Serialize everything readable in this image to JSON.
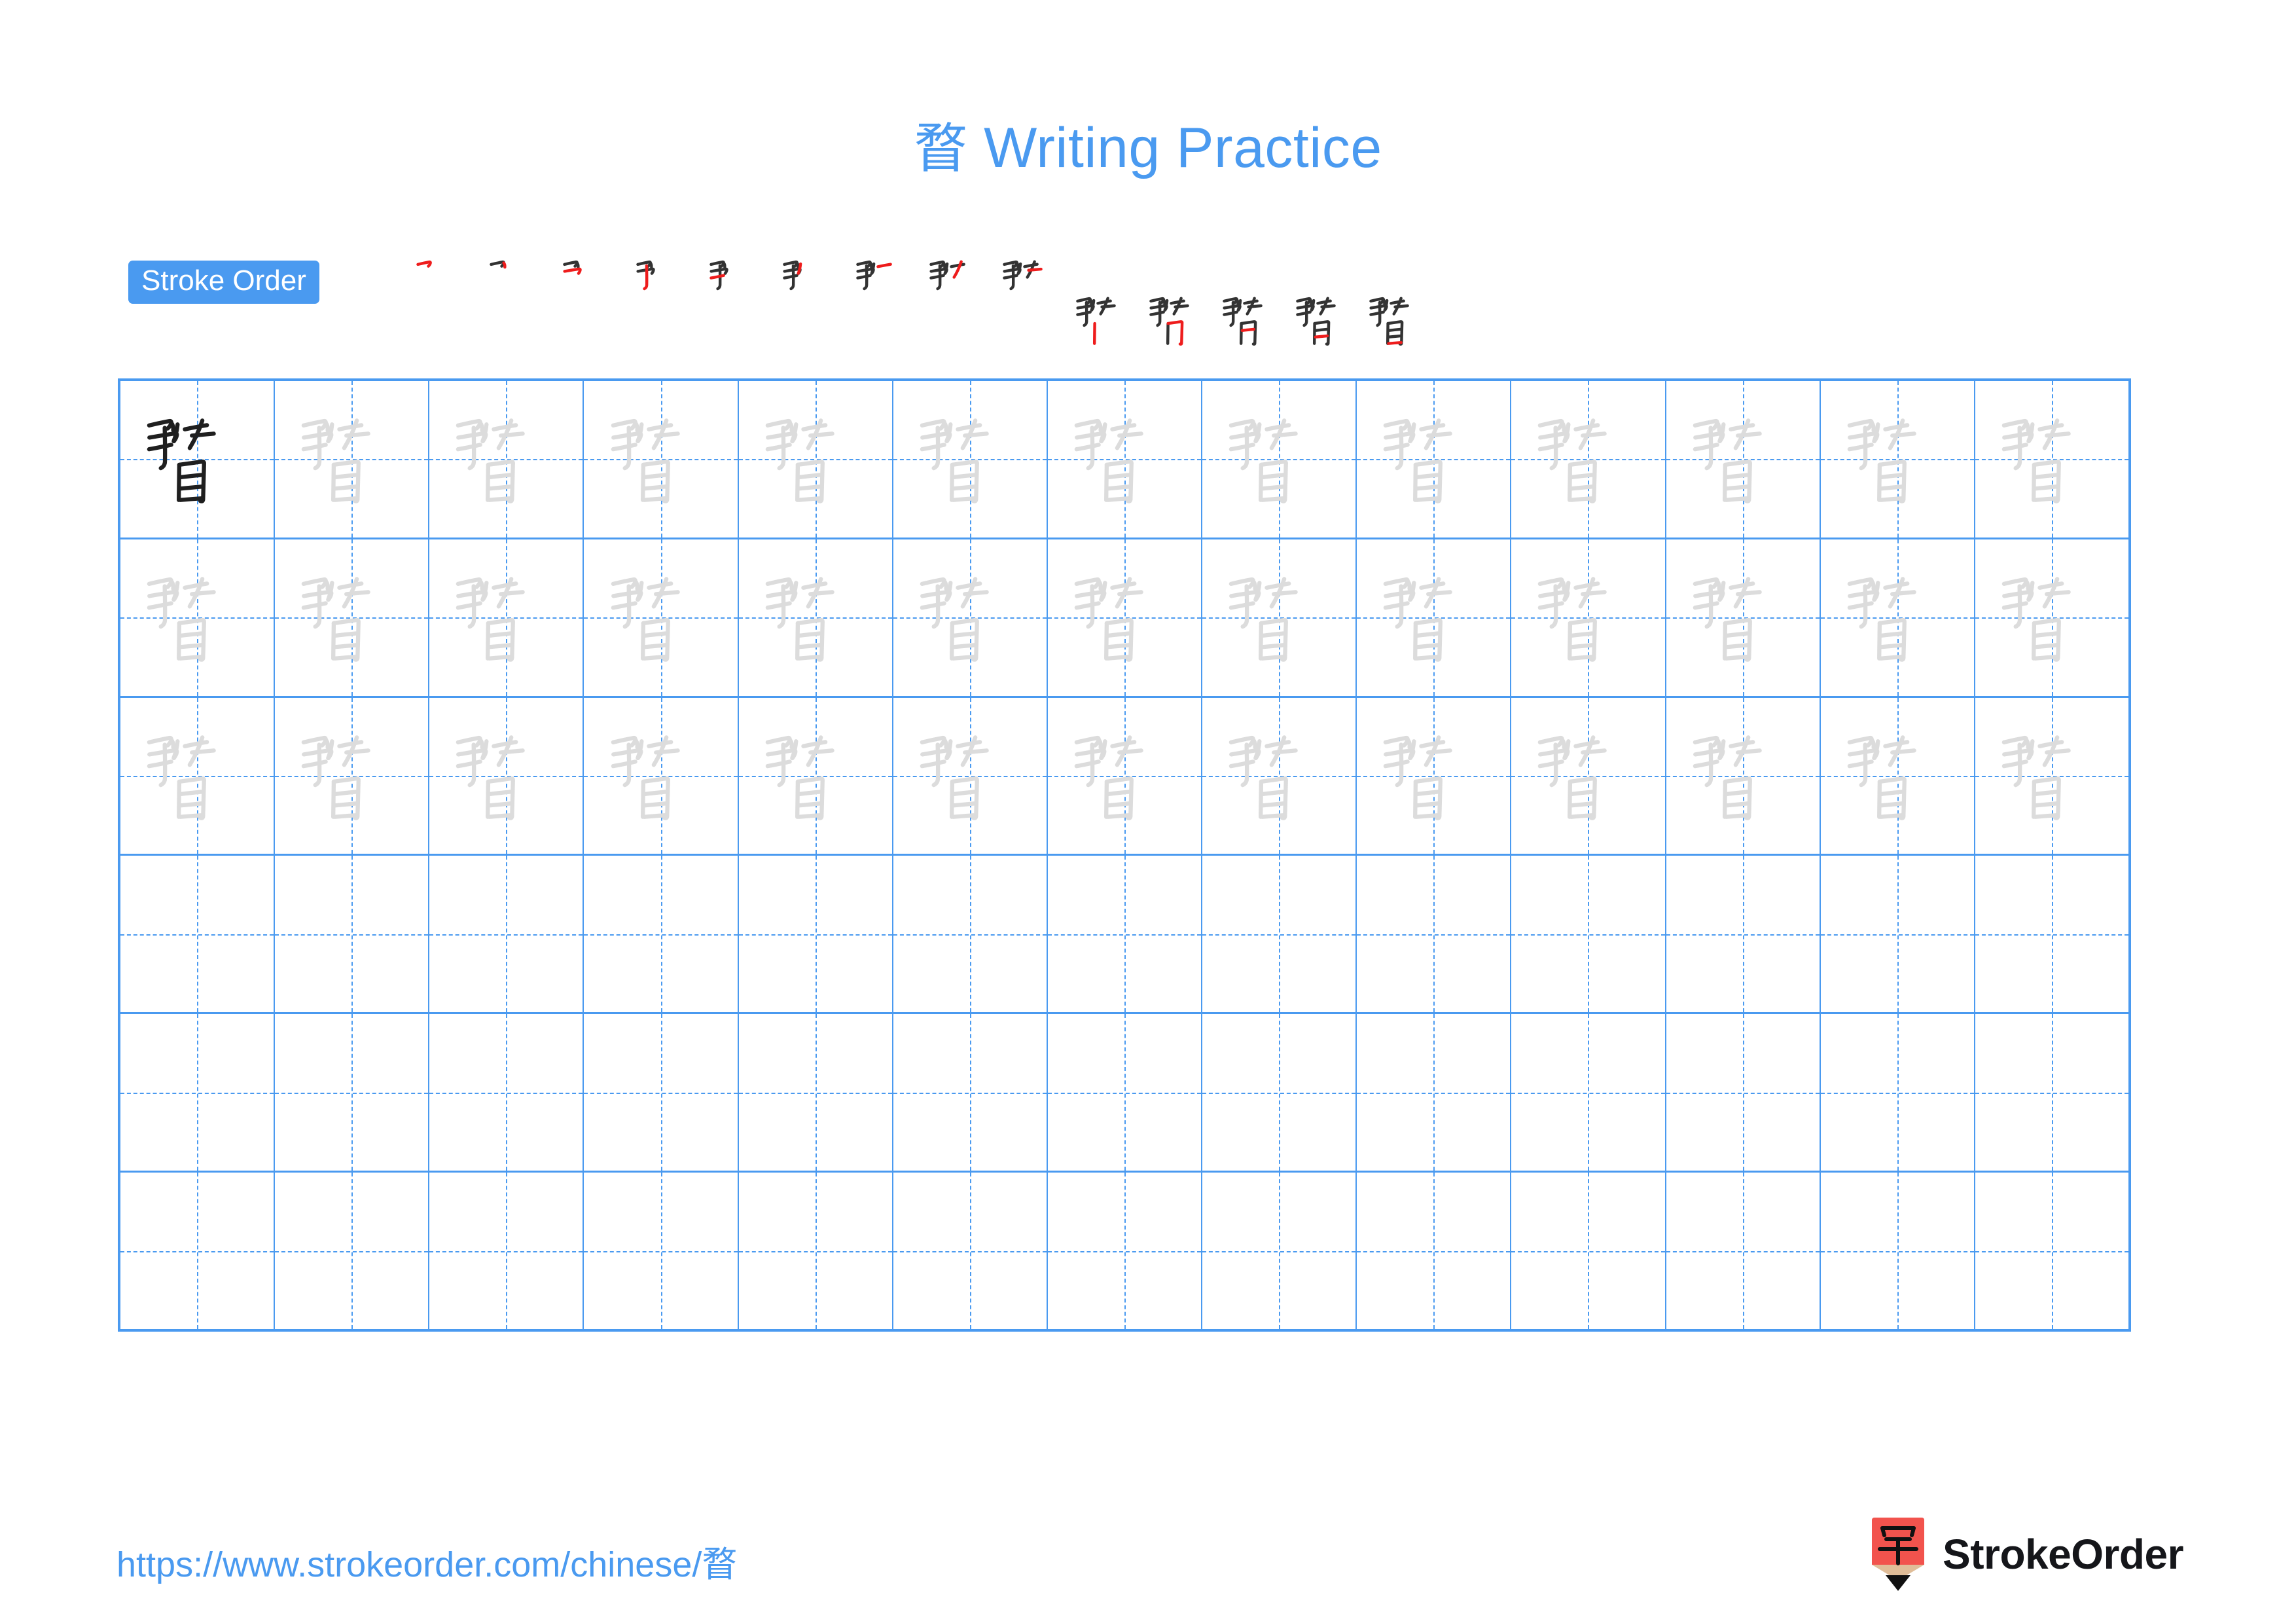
{
  "page": {
    "character": "瞀",
    "title_suffix": " Writing Practice",
    "accent_color": "#4a9af0",
    "stroke_current_color": "#ee1c1c",
    "stroke_done_color": "#333333",
    "trace_color": "#dcdcdc",
    "model_color": "#1f1f1f"
  },
  "stroke_order": {
    "badge_label": "Stroke Order",
    "total_strokes": 14,
    "steps": [
      {
        "index": 1,
        "label": "stroke-1",
        "row": 0
      },
      {
        "index": 2,
        "label": "stroke-2",
        "row": 0
      },
      {
        "index": 3,
        "label": "stroke-3",
        "row": 0
      },
      {
        "index": 4,
        "label": "stroke-4",
        "row": 0
      },
      {
        "index": 5,
        "label": "stroke-5",
        "row": 0
      },
      {
        "index": 6,
        "label": "stroke-6",
        "row": 0
      },
      {
        "index": 7,
        "label": "stroke-7",
        "row": 0
      },
      {
        "index": 8,
        "label": "stroke-8",
        "row": 0
      },
      {
        "index": 9,
        "label": "stroke-9",
        "row": 0
      },
      {
        "index": 10,
        "label": "stroke-10",
        "row": 1
      },
      {
        "index": 11,
        "label": "stroke-11",
        "row": 1
      },
      {
        "index": 12,
        "label": "stroke-12",
        "row": 1
      },
      {
        "index": 13,
        "label": "stroke-13",
        "row": 1
      },
      {
        "index": 14,
        "label": "stroke-14",
        "row": 1
      }
    ]
  },
  "grid": {
    "columns": 13,
    "rows": 6,
    "filled_rows": 3,
    "empty_rows": 3,
    "model_cell": {
      "row": 0,
      "column": 0
    }
  },
  "footer": {
    "url": "https://www.strokeorder.com/chinese/瞀",
    "brand": "StrokeOrder",
    "logo_glyph": "字",
    "logo_body_color": "#f2534d",
    "logo_wood_color": "#e0bd98",
    "logo_tip_color": "#111111"
  }
}
